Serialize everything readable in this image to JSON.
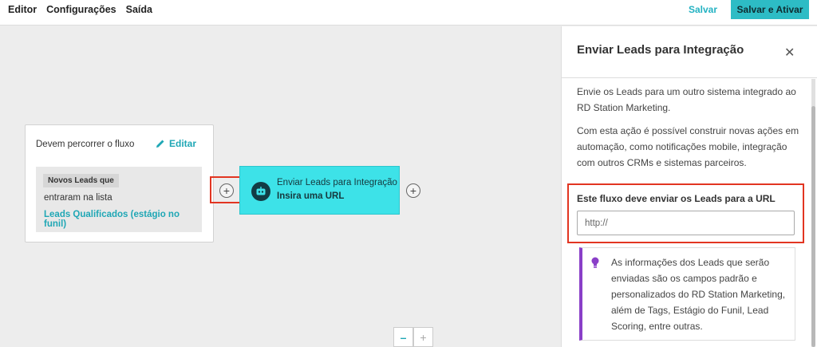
{
  "menu": {
    "items": [
      "Editor",
      "Configurações",
      "Saída"
    ]
  },
  "toolbar": {
    "save_label": "Salvar",
    "save_activate_label": "Salvar e Ativar"
  },
  "canvas": {
    "start_card": {
      "title": "Devem percorrer o fluxo",
      "edit_label": "Editar",
      "badge": "Novos Leads que",
      "text": "entraram na lista",
      "link": "Leads Qualificados (estágio no funil)"
    },
    "action_card": {
      "title": "Enviar Leads para Integração",
      "subtitle": "Insira uma URL"
    },
    "plus_symbol": "+",
    "zoom": {
      "minus": "–",
      "plus": "+"
    }
  },
  "panel": {
    "title": "Enviar Leads para Integração",
    "close": "✕",
    "paragraph1": "Envie os Leads para um outro sistema integrado ao RD Station Marketing.",
    "paragraph2": "Com esta ação é possível construir novas ações em automação, como notificações mobile, integração com outros CRMs e sistemas parceiros.",
    "url_label": "Este fluxo deve enviar os Leads para a URL",
    "url_placeholder": "http://",
    "info_text": "As informações dos Leads que serão enviadas são os campos padrão e personalizados do RD Station Marketing, além de Tags, Estágio do Funil, Lead Scoring, entre outras."
  },
  "colors": {
    "accent": "#2dbcc5",
    "action_card": "#3de2e8",
    "highlight": "#e23521",
    "info_border": "#8a3fc8"
  },
  "icons": [
    "pencil-icon",
    "robot-icon",
    "plus-icon",
    "close-icon",
    "lightbulb-icon"
  ]
}
